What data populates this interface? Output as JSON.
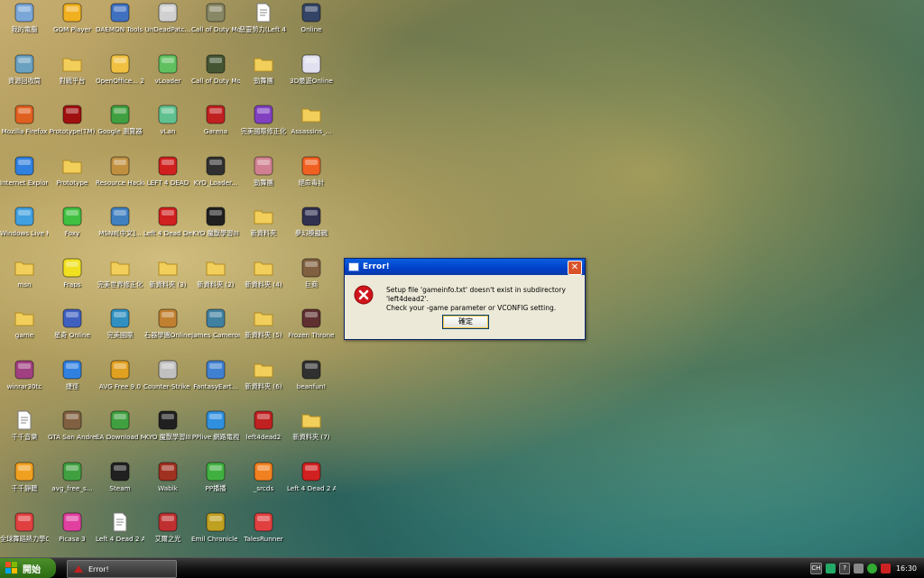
{
  "desktop": {
    "icons": [
      {
        "label": "我的電腦",
        "icon": "computer-icon",
        "color": "#7aa6d8"
      },
      {
        "label": "GOM Player",
        "icon": "gom-player-icon",
        "color": "#f0b020"
      },
      {
        "label": "DAEMON Tools Lite",
        "icon": "daemon-tools-icon",
        "color": "#4070c0"
      },
      {
        "label": "UnDeadPatc...",
        "icon": "app-icon",
        "color": "#d0d0d0"
      },
      {
        "label": "Call of Duty Modern W...",
        "icon": "cod-icon",
        "color": "#888866"
      },
      {
        "label": "惡靈勢力(Left 4 Dead ...",
        "icon": "document-icon",
        "color": "#ffffff"
      },
      {
        "label": "Online",
        "icon": "game-icon",
        "color": "#334466"
      },
      {
        "label": "資源回收筒",
        "icon": "recycle-bin-icon",
        "color": "#6aa0c0"
      },
      {
        "label": "對戰平台",
        "icon": "folder-icon",
        "color": "#f2cf5b"
      },
      {
        "label": "OpenOffice... 2.3 Installa...",
        "icon": "openoffice-icon",
        "color": "#f0c040"
      },
      {
        "label": "vLoader",
        "icon": "vloader-icon",
        "color": "#60c060"
      },
      {
        "label": "Call of Duty Modern W...",
        "icon": "cod-icon",
        "color": "#445533"
      },
      {
        "label": "勁舞團",
        "icon": "folder-icon",
        "color": "#f2cf5b"
      },
      {
        "label": "3D最遊Online",
        "icon": "window-icon",
        "color": "#e0e0f0"
      },
      {
        "label": "Mozilla Firefox",
        "icon": "firefox-icon",
        "color": "#e06020"
      },
      {
        "label": "Prototype(TM)",
        "icon": "prototype-icon",
        "color": "#a01010"
      },
      {
        "label": "Google 瀏覽器",
        "icon": "chrome-icon",
        "color": "#40a040"
      },
      {
        "label": "vLan",
        "icon": "vlan-icon",
        "color": "#60c090"
      },
      {
        "label": "Garena",
        "icon": "garena-icon",
        "color": "#c02020"
      },
      {
        "label": "完美國際修正化",
        "icon": "game-icon",
        "color": "#8040c0"
      },
      {
        "label": "Assassins_...",
        "icon": "folder-icon",
        "color": "#f2cf5b"
      },
      {
        "label": "Internet Explorer",
        "icon": "ie-icon",
        "color": "#3080e0"
      },
      {
        "label": "Prototype",
        "icon": "folder-icon",
        "color": "#f2cf5b"
      },
      {
        "label": "Resource Hacker",
        "icon": "resource-hacker-icon",
        "color": "#c09040"
      },
      {
        "label": "LEFT 4 DEAD",
        "icon": "l4d-icon",
        "color": "#d02020"
      },
      {
        "label": "KYO_Loader...",
        "icon": "app-icon",
        "color": "#303030"
      },
      {
        "label": "勁舞團",
        "icon": "game-icon",
        "color": "#d08090"
      },
      {
        "label": "絕命毒計",
        "icon": "game-icon",
        "color": "#f06020"
      },
      {
        "label": "Windows Live Messenger",
        "icon": "messenger-icon",
        "color": "#40a0e0"
      },
      {
        "label": "Foxy",
        "icon": "foxy-icon",
        "color": "#40c040"
      },
      {
        "label": "MSN8[中文]...",
        "icon": "msn-icon",
        "color": "#4080c0"
      },
      {
        "label": "Left 4 Dead Dedicate...",
        "icon": "l4d-icon",
        "color": "#d02020"
      },
      {
        "label": "KYO 魔獸學習III",
        "icon": "game-icon",
        "color": "#202020"
      },
      {
        "label": "新資料夾",
        "icon": "folder-icon",
        "color": "#f2cf5b"
      },
      {
        "label": "夢幻模擬戰",
        "icon": "game-icon",
        "color": "#303050"
      },
      {
        "label": "msn",
        "icon": "folder-icon",
        "color": "#f2cf5b"
      },
      {
        "label": "Fraps",
        "icon": "fraps-icon",
        "color": "#f0e020"
      },
      {
        "label": "完美世界修正化",
        "icon": "folder-icon",
        "color": "#f2cf5b"
      },
      {
        "label": "新資料夾 (3)",
        "icon": "folder-icon",
        "color": "#f2cf5b"
      },
      {
        "label": "新資料夾 (2)",
        "icon": "folder-icon",
        "color": "#f2cf5b"
      },
      {
        "label": "新資料夾 (4)",
        "icon": "folder-icon",
        "color": "#f2cf5b"
      },
      {
        "label": "巨商",
        "icon": "game-icon",
        "color": "#806040"
      },
      {
        "label": "game",
        "icon": "folder-icon",
        "color": "#f2cf5b"
      },
      {
        "label": "星奇 Online",
        "icon": "game-icon",
        "color": "#4060c0"
      },
      {
        "label": "完美國際",
        "icon": "game-icon",
        "color": "#3090c0"
      },
      {
        "label": "石器學園Online",
        "icon": "game-icon",
        "color": "#c08030"
      },
      {
        "label": "James Cameron's...",
        "icon": "game-icon",
        "color": "#4080a0"
      },
      {
        "label": "新資料夾 (5)",
        "icon": "folder-icon",
        "color": "#f2cf5b"
      },
      {
        "label": "Frozen Throne",
        "icon": "game-icon",
        "color": "#603030"
      },
      {
        "label": "winrar30tc",
        "icon": "winrar-icon",
        "color": "#a04080"
      },
      {
        "label": "捷徑",
        "icon": "app-icon",
        "color": "#3080e0"
      },
      {
        "label": "AVG Free 9.0",
        "icon": "avg-icon",
        "color": "#e0a020"
      },
      {
        "label": "Counter-Strike Online",
        "icon": "cs-icon",
        "color": "#c0c0c0"
      },
      {
        "label": "FantasyEart...",
        "icon": "app-icon",
        "color": "#4080d0"
      },
      {
        "label": "新資料夾 (6)",
        "icon": "folder-icon",
        "color": "#f2cf5b"
      },
      {
        "label": "beanfun!",
        "icon": "game-icon",
        "color": "#303030"
      },
      {
        "label": "千千音樂",
        "icon": "document-icon",
        "color": "#ffffff"
      },
      {
        "label": "GTA San Andreas",
        "icon": "gta-icon",
        "color": "#806040"
      },
      {
        "label": "EA Download Manager",
        "icon": "ea-icon",
        "color": "#40a040"
      },
      {
        "label": "KYO 魔獸學習III",
        "icon": "game-icon",
        "color": "#202020"
      },
      {
        "label": "PPlive 網路電視",
        "icon": "pplive-icon",
        "color": "#3090e0"
      },
      {
        "label": "left4dead2",
        "icon": "l4d2-icon",
        "color": "#c02020"
      },
      {
        "label": "新資料夾 (7)",
        "icon": "folder-icon",
        "color": "#f2cf5b"
      },
      {
        "label": "千千靜聽",
        "icon": "ttplayer-icon",
        "color": "#f0a020"
      },
      {
        "label": "avg_free_s...",
        "icon": "avg-icon",
        "color": "#40a040"
      },
      {
        "label": "Steam",
        "icon": "steam-icon",
        "color": "#202020"
      },
      {
        "label": "Wabik",
        "icon": "game-icon",
        "color": "#a03020"
      },
      {
        "label": "PP播播",
        "icon": "ppstream-icon",
        "color": "#40b040"
      },
      {
        "label": "_srcds",
        "icon": "halflife-icon",
        "color": "#f08020"
      },
      {
        "label": "Left 4 Dead 2 Add-on Su...",
        "icon": "l4d-icon",
        "color": "#d02020"
      },
      {
        "label": "全球舞蹈熱力學Online",
        "icon": "game-icon",
        "color": "#e04040"
      },
      {
        "label": "Picasa 3",
        "icon": "picasa-icon",
        "color": "#e040a0"
      },
      {
        "label": "Left 4 Dead 2 Authoring ...",
        "icon": "document-icon",
        "color": "#ffffff"
      },
      {
        "label": "艾爾之光",
        "icon": "game-icon",
        "color": "#c03030"
      },
      {
        "label": "Emil Chronicle Online.exe",
        "icon": "game-icon",
        "color": "#c0a020"
      },
      {
        "label": "TalesRunner",
        "icon": "game-icon",
        "color": "#e04040"
      }
    ]
  },
  "dialog": {
    "title": "Error!",
    "close_symbol": "✕",
    "message_line1": "Setup file 'gameinfo.txt' doesn't exist in subdirectory 'left4dead2'.",
    "message_line2": "Check your -game parameter or VCONFIG setting.",
    "ok_label": "確定"
  },
  "taskbar": {
    "start_label": "開始",
    "task_label": "Error!",
    "tray": {
      "lang": "CH",
      "help": "?",
      "clock": "16:30"
    }
  }
}
